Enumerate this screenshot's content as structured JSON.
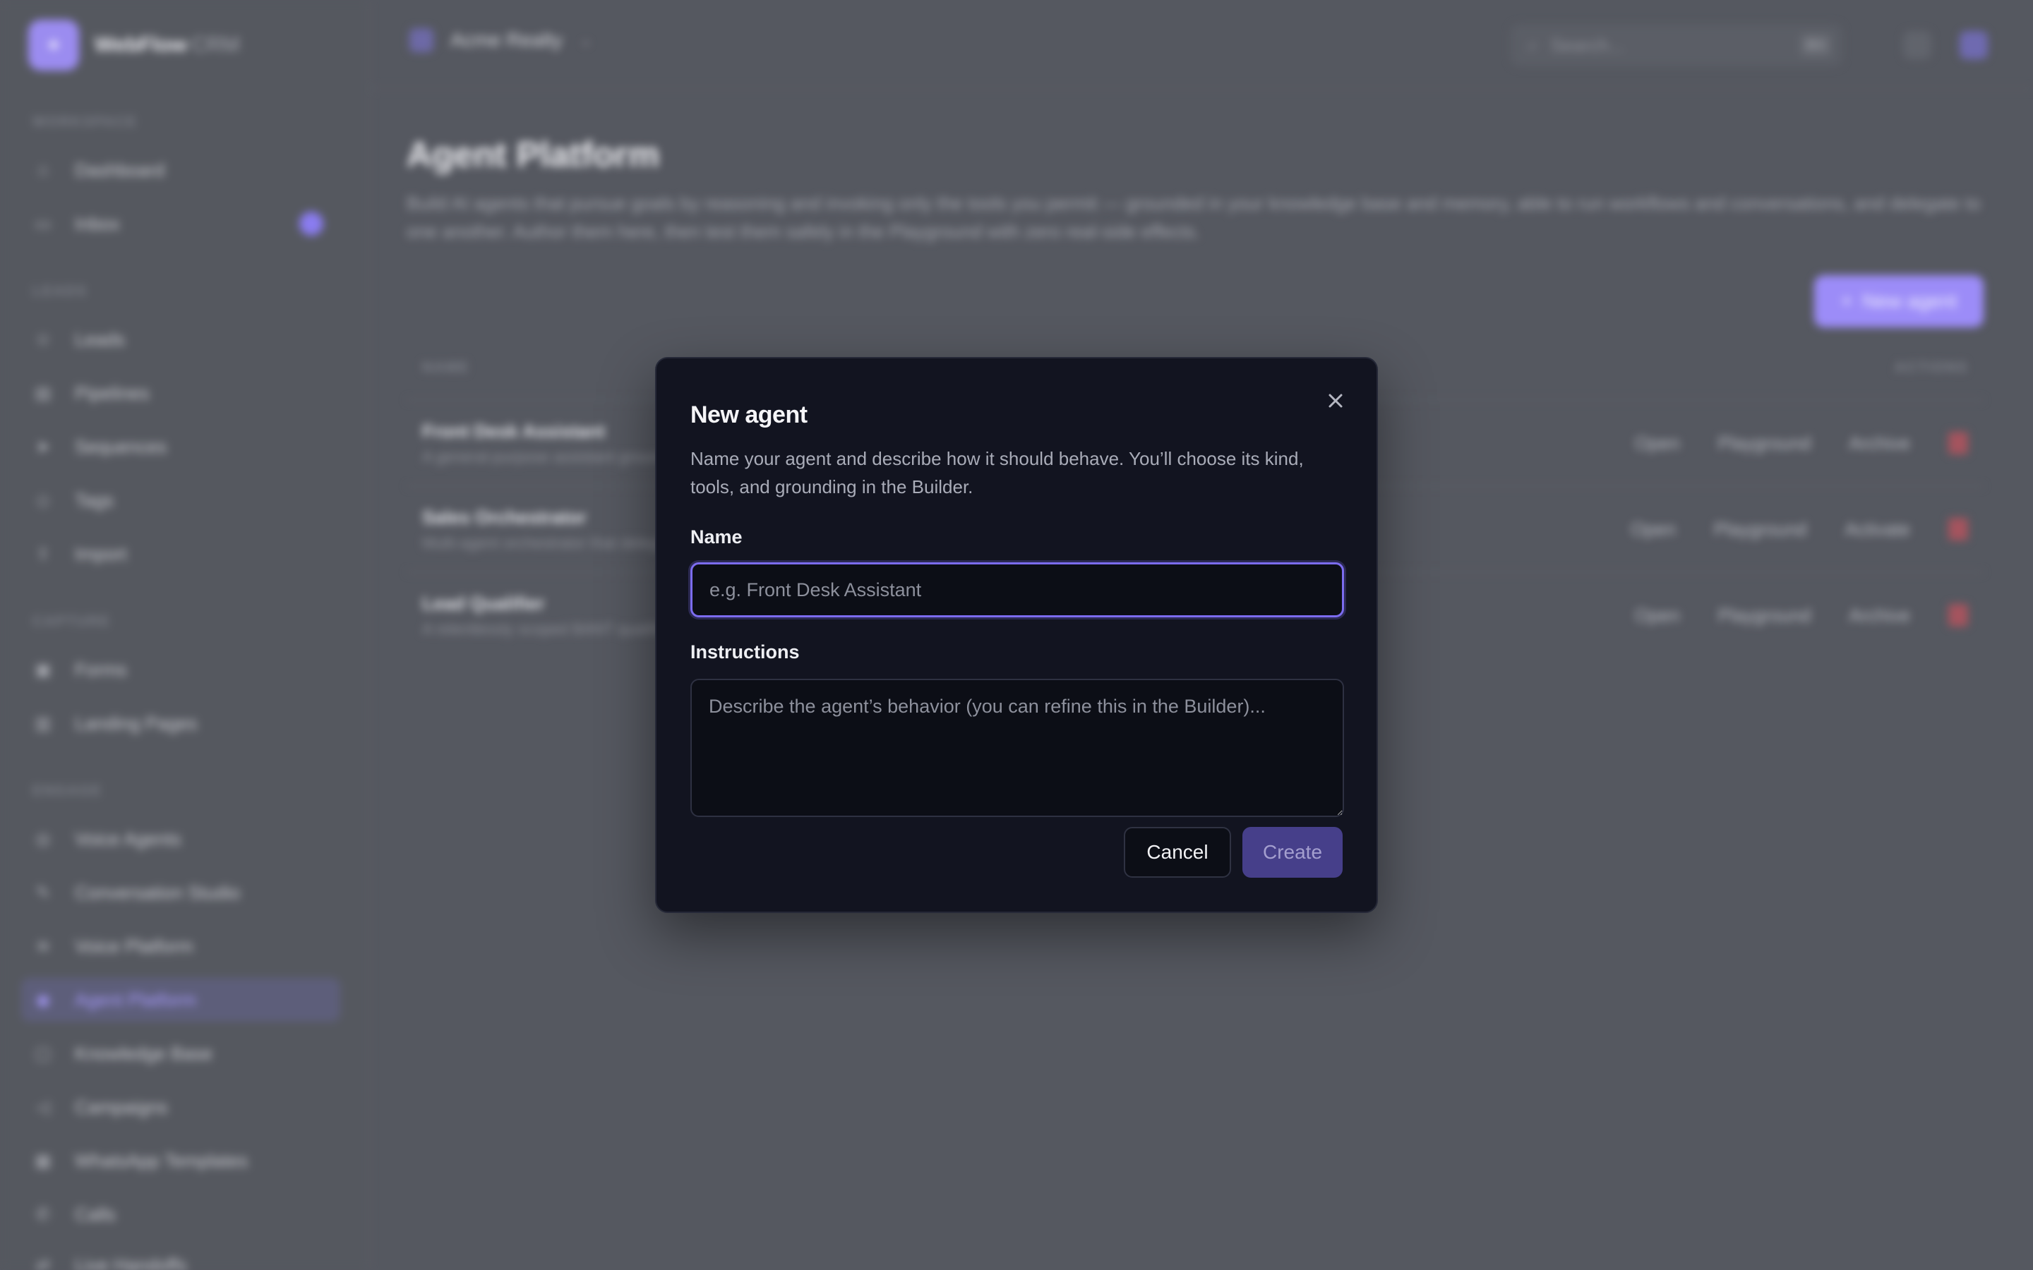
{
  "brand": {
    "name": "WebFlow",
    "suffix": "CRM"
  },
  "sidebar": {
    "sections": [
      {
        "label": "WORKSPACE",
        "items": [
          {
            "label": "Dashboard",
            "icon": "home-icon"
          },
          {
            "label": "Inbox",
            "icon": "inbox-icon"
          }
        ]
      },
      {
        "label": "LEADS",
        "items": [
          {
            "label": "Leads",
            "icon": "users-icon"
          },
          {
            "label": "Pipelines",
            "icon": "pipeline-icon"
          },
          {
            "label": "Sequences",
            "icon": "send-icon"
          },
          {
            "label": "Tags",
            "icon": "tag-icon"
          },
          {
            "label": "Import",
            "icon": "upload-icon"
          }
        ]
      },
      {
        "label": "CAPTURE",
        "items": [
          {
            "label": "Forms",
            "icon": "form-icon"
          },
          {
            "label": "Landing Pages",
            "icon": "page-icon"
          }
        ]
      },
      {
        "label": "ENGAGE",
        "items": [
          {
            "label": "Voice Agents",
            "icon": "mic-icon"
          },
          {
            "label": "Conversation Studio",
            "icon": "chat-icon"
          },
          {
            "label": "Voice Platform",
            "icon": "wave-icon"
          },
          {
            "label": "Agent Platform",
            "icon": "bot-icon"
          },
          {
            "label": "Knowledge Base",
            "icon": "book-icon"
          },
          {
            "label": "Campaigns",
            "icon": "megaphone-icon"
          },
          {
            "label": "WhatsApp Templates",
            "icon": "whatsapp-icon"
          },
          {
            "label": "Calls",
            "icon": "phone-icon"
          },
          {
            "label": "Live Handoffs",
            "icon": "handoff-icon"
          }
        ]
      }
    ]
  },
  "topbar": {
    "org_name": "Acme Realty",
    "search_placeholder": "Search...",
    "search_shortcut": "⌘K"
  },
  "main": {
    "title": "Agent Platform",
    "description": "Build AI agents that pursue goals by reasoning and invoking only the tools you permit — grounded in your knowledge base and memory, able to run workflows and conversations, and delegate to one another. Author them here, then test them safely in the Playground with zero real-side effects.",
    "new_agent_label": "New agent",
    "columns": {
      "name": "NAME",
      "actions": "ACTIONS"
    },
    "agents": [
      {
        "name": "Front Desk Assistant",
        "sub": "A general-purpose assistant grounded in your knowledge base",
        "toggle_label": "Archive"
      },
      {
        "name": "Sales Orchestrator",
        "sub": "Multi-agent orchestrator that delegates to specialist agents",
        "toggle_label": "Activate"
      },
      {
        "name": "Lead Qualifier",
        "sub": "A relentlessly scoped BANT qualifier for inbound leads",
        "toggle_label": "Archive"
      }
    ],
    "open_label": "Open",
    "playground_label": "Playground"
  },
  "modal": {
    "title": "New agent",
    "description": "Name your agent and describe how it should behave. You’ll choose its kind, tools, and grounding in the Builder.",
    "name_label": "Name",
    "name_placeholder": "e.g. Front Desk Assistant",
    "name_value": "",
    "instructions_label": "Instructions",
    "instructions_placeholder": "Describe the agent’s behavior (you can refine this in the Builder)...",
    "instructions_value": "",
    "cancel_label": "Cancel",
    "create_label": "Create"
  },
  "colors": {
    "accent": "#7c6cf0",
    "modal_bg": "#121420",
    "create_disabled": "#463f8a"
  }
}
